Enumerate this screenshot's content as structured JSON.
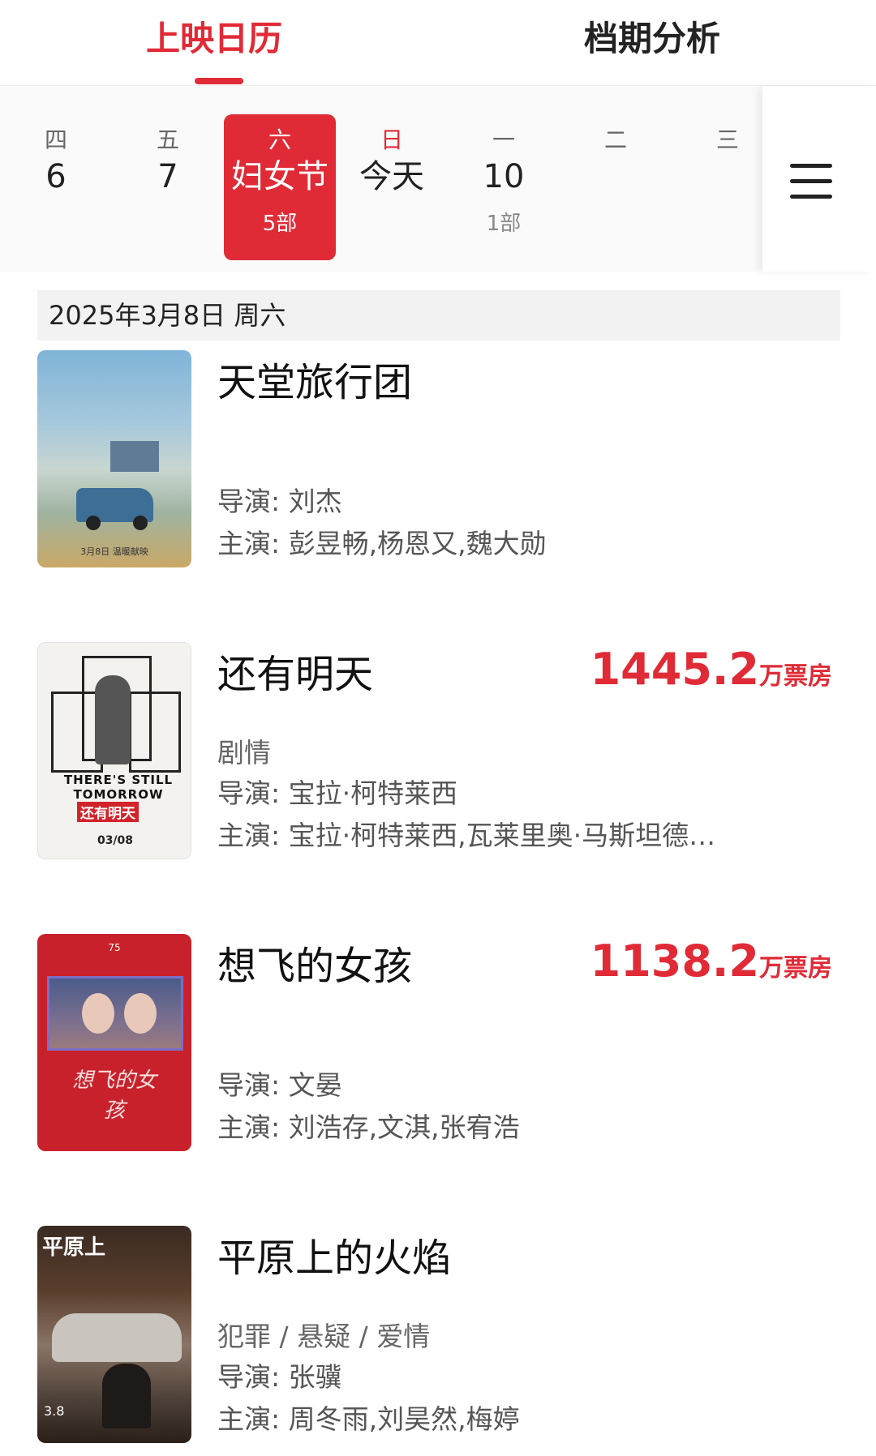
{
  "tabs": {
    "active": "上映日历",
    "inactive": "档期分析"
  },
  "date_strip": [
    {
      "weekday": "四",
      "day": "6",
      "count": ""
    },
    {
      "weekday": "五",
      "day": "7",
      "count": ""
    },
    {
      "weekday": "六",
      "day": "妇女节",
      "count": "5部",
      "selected": true
    },
    {
      "weekday": "日",
      "day": "今天",
      "count": "",
      "today": true
    },
    {
      "weekday": "一",
      "day": "10",
      "count": "1部"
    },
    {
      "weekday": "二",
      "day": "",
      "count": ""
    },
    {
      "weekday": "三",
      "day": "",
      "count": ""
    }
  ],
  "date_header": "2025年3月8日  周六",
  "movies": [
    {
      "title": "天堂旅行团",
      "genre": "",
      "director": "导演: 刘杰",
      "cast": "主演: 彭昱畅,杨恩又,魏大勋",
      "poster_text": "3月8日 温暖献映",
      "box_office": "",
      "box_office_unit": ""
    },
    {
      "title": "还有明天",
      "genre": "剧情",
      "director": "导演: 宝拉·柯特莱西",
      "cast": "主演: 宝拉·柯特莱西,瓦莱里奥·马斯坦德…",
      "poster_text_en": "THERE'S STILL TOMORROW",
      "poster_text_zh": "还有明天",
      "poster_date": "03/08",
      "box_office": "1445.2",
      "box_office_unit": "万票房"
    },
    {
      "title": "想飞的女孩",
      "genre": "",
      "director": "导演: 文晏",
      "cast": "主演: 刘浩存,文淇,张宥浩",
      "poster_badge": "75",
      "poster_calligraphy": "想飞的女孩",
      "box_office": "1138.2",
      "box_office_unit": "万票房"
    },
    {
      "title": "平原上的火焰",
      "genre": "犯罪 / 悬疑 / 爱情",
      "director": "导演: 张骥",
      "cast": "主演: 周冬雨,刘昊然,梅婷",
      "poster_title": "平原上",
      "poster_date": "3.8",
      "box_office": "",
      "box_office_unit": ""
    }
  ],
  "colors": {
    "accent": "#e02b37",
    "text": "#222222",
    "muted": "#888888"
  },
  "icons": {
    "menu": "hamburger-menu-icon"
  }
}
